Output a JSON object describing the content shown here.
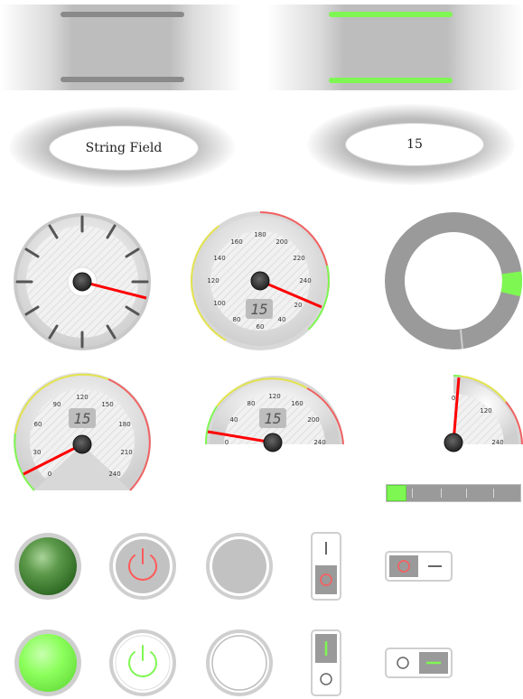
{
  "string_field": {
    "value": "String Field"
  },
  "numeric_field": {
    "value": "15"
  },
  "gauges": {
    "full_value": "15",
    "left_value": "15",
    "flat_value": "15"
  },
  "full_gauge_labels": [
    "20",
    "40",
    "60",
    "80",
    "100",
    "120",
    "140",
    "160",
    "180",
    "200",
    "220",
    "240"
  ],
  "left_gauge_labels": [
    "0",
    "30",
    "60",
    "90",
    "120",
    "150",
    "180",
    "210",
    "240"
  ],
  "flat_gauge_labels": [
    "0",
    "40",
    "80",
    "120",
    "160",
    "200",
    "240"
  ],
  "quarter_gauge_labels": [
    "0",
    "120",
    "240"
  ],
  "level_bar": {
    "fill_fraction": 0.15
  },
  "ring": {
    "fill_fraction": 0.06
  },
  "colors": {
    "accent_green": "#7ff752",
    "needle_red": "#ff0000",
    "gray": "#9a9a9a"
  },
  "icons": [
    "power-icon",
    "power-icon",
    "ring-button-icon",
    "toggle-switch-icon"
  ]
}
